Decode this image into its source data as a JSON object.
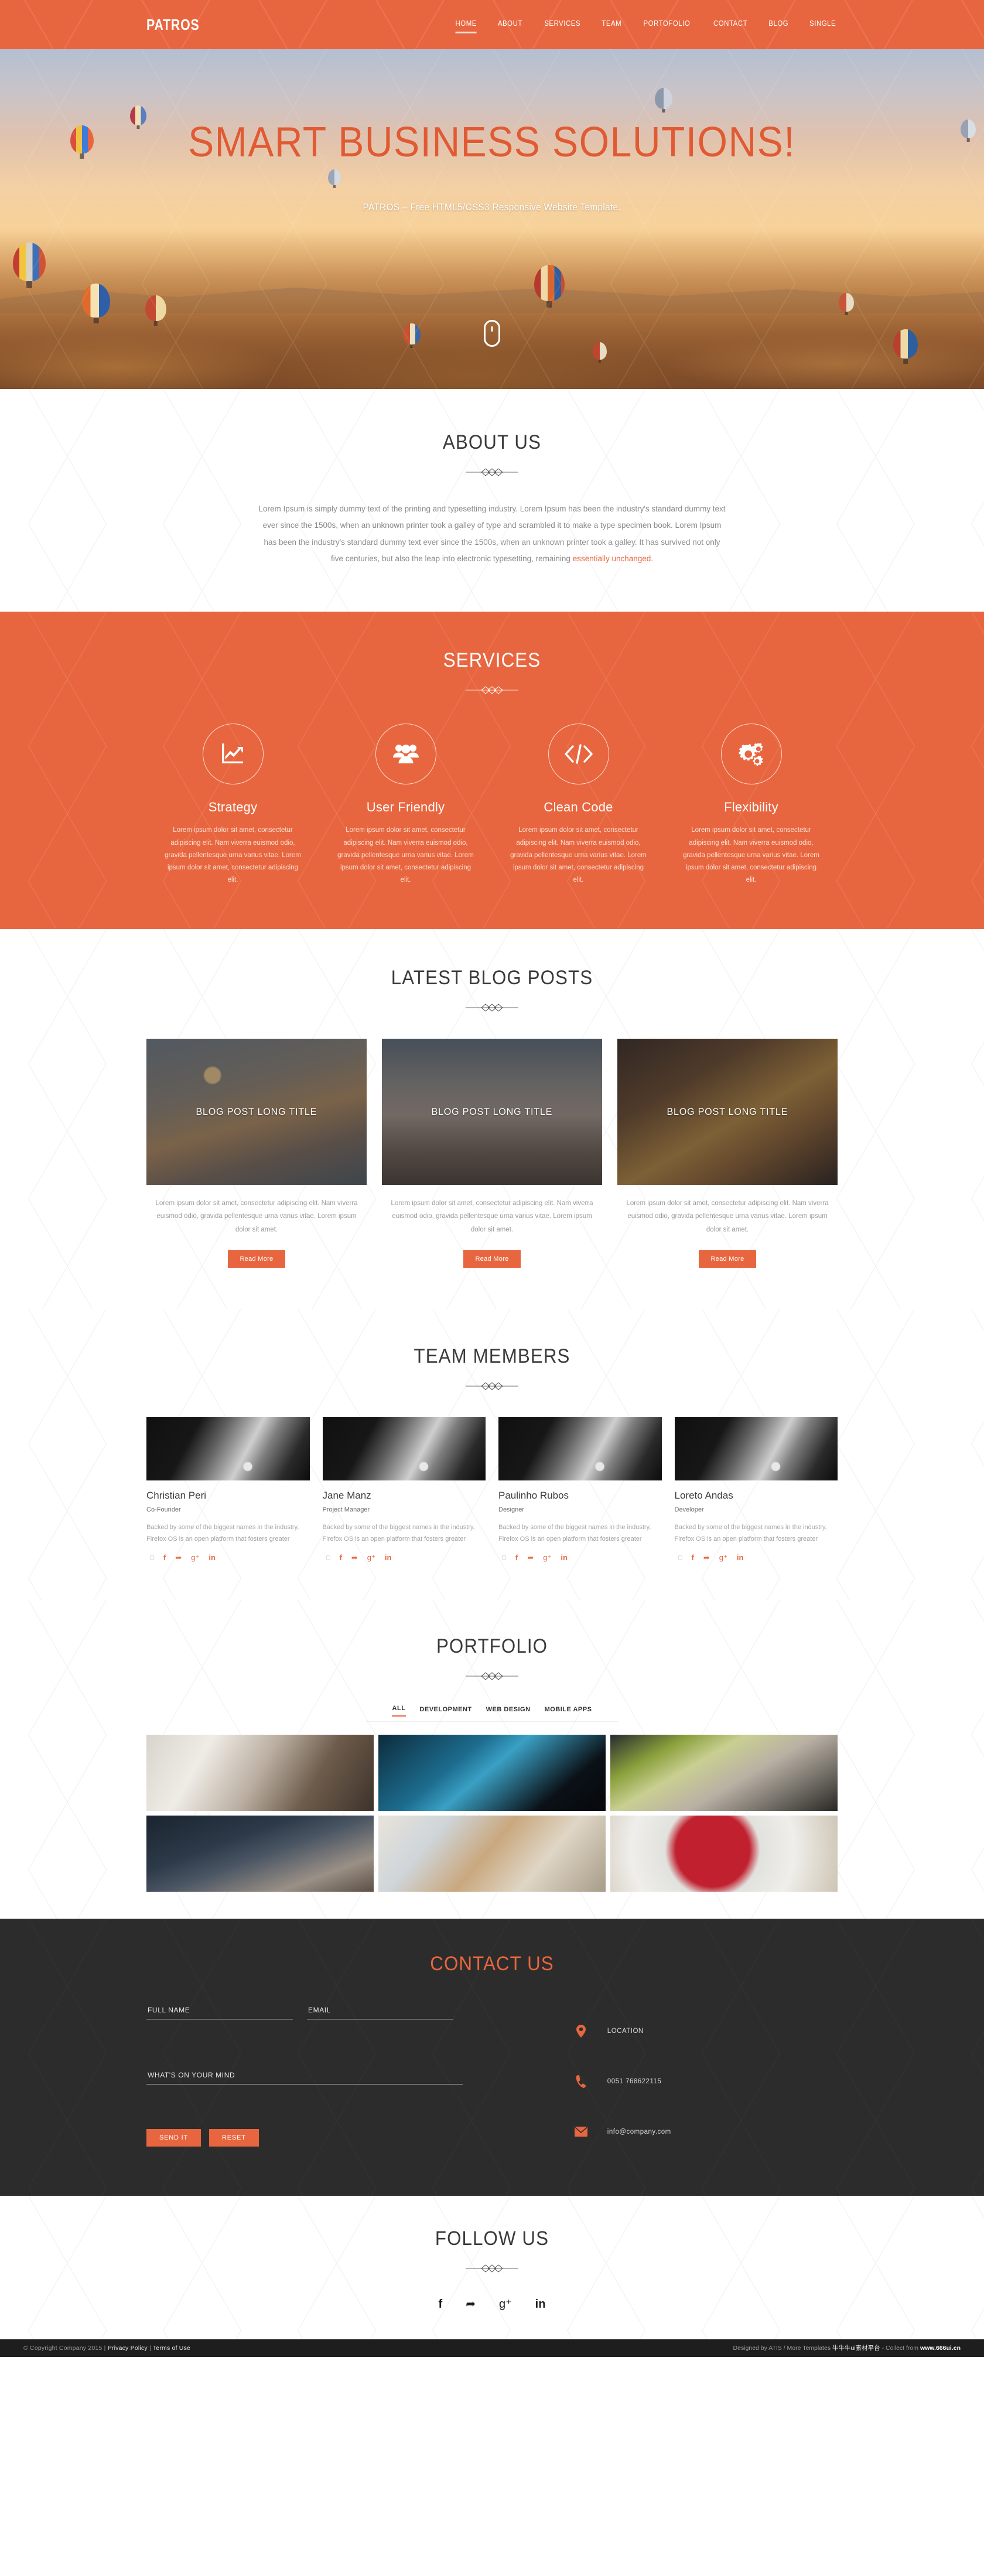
{
  "brand": {
    "logo": "PATROS",
    "accent": "#e8663f",
    "dark": "#2c2c2c"
  },
  "nav": {
    "items": [
      {
        "label": "HOME",
        "active": true
      },
      {
        "label": "ABOUT",
        "active": false
      },
      {
        "label": "SERVICES",
        "active": false
      },
      {
        "label": "TEAM",
        "active": false
      },
      {
        "label": "PORTOFOLIO",
        "active": false
      },
      {
        "label": "CONTACT",
        "active": false
      },
      {
        "label": "BLOG",
        "active": false
      },
      {
        "label": "SINGLE",
        "active": false
      }
    ]
  },
  "hero": {
    "title": "SMART BUSINESS SOLUTIONS!",
    "subtitle": "PATROS – Free HTML5/CSS3 Responsive Website Template.",
    "scroll_icon": "mouse-scroll-icon"
  },
  "about": {
    "title": "ABOUT US",
    "body": "Lorem Ipsum is simply dummy text of the printing and typesetting industry. Lorem Ipsum has been the industry's standard dummy text ever since the 1500s, when an unknown printer took a galley of type and scrambled it to make a type specimen book. Lorem Ipsum has been the industry's standard dummy text ever since the 1500s, when an unknown printer took a galley. It has survived not only five centuries, but also the leap into electronic typesetting, remaining ",
    "highlight": "essentially unchanged."
  },
  "services": {
    "title": "SERVICES",
    "items": [
      {
        "icon": "chart-growth-icon",
        "name": "Strategy",
        "desc": "Lorem ipsum dolor sit amet, consectetur adipiscing elit. Nam viverra euismod odio, gravida pellentesque urna varius vitae. Lorem ipsum dolor sit amet, consectetur adipiscing elit."
      },
      {
        "icon": "users-group-icon",
        "name": "User Friendly",
        "desc": "Lorem ipsum dolor sit amet, consectetur adipiscing elit. Nam viverra euismod odio, gravida pellentesque urna varius vitae. Lorem ipsum dolor sit amet, consectetur adipiscing elit."
      },
      {
        "icon": "code-brackets-icon",
        "name": "Clean Code",
        "desc": "Lorem ipsum dolor sit amet, consectetur adipiscing elit. Nam viverra euismod odio, gravida pellentesque urna varius vitae. Lorem ipsum dolor sit amet, consectetur adipiscing elit."
      },
      {
        "icon": "gears-icon",
        "name": "Flexibility",
        "desc": "Lorem ipsum dolor sit amet, consectetur adipiscing elit. Nam viverra euismod odio, gravida pellentesque urna varius vitae. Lorem ipsum dolor sit amet, consectetur adipiscing elit."
      }
    ]
  },
  "blog": {
    "title": "LATEST BLOG POSTS",
    "posts": [
      {
        "title": "BLOG POST LONG TITLE",
        "excerpt": "Lorem ipsum dolor sit amet, consectetur adipiscing elit. Nam viverra euismod odio, gravida pellentesque urna varius vitae. Lorem ipsum dolor sit amet.",
        "button": "Read More"
      },
      {
        "title": "BLOG POST LONG TITLE",
        "excerpt": "Lorem ipsum dolor sit amet, consectetur adipiscing elit. Nam viverra euismod odio, gravida pellentesque urna varius vitae. Lorem ipsum dolor sit amet.",
        "button": "Read More"
      },
      {
        "title": "BLOG POST LONG TITLE",
        "excerpt": "Lorem ipsum dolor sit amet, consectetur adipiscing elit. Nam viverra euismod odio, gravida pellentesque urna varius vitae. Lorem ipsum dolor sit amet.",
        "button": "Read More"
      }
    ]
  },
  "team": {
    "title": "TEAM MEMBERS",
    "members": [
      {
        "name": "Christian Peri",
        "role": "Co-Founder",
        "bio": "Backed by some of the biggest names in the industry, Firefox OS is an open platform that fosters greater"
      },
      {
        "name": "Jane Manz",
        "role": "Project Manager",
        "bio": "Backed by some of the biggest names in the industry, Firefox OS is an open platform that fosters greater"
      },
      {
        "name": "Paulinho Rubos",
        "role": "Designer",
        "bio": "Backed by some of the biggest names in the industry, Firefox OS is an open platform that fosters greater"
      },
      {
        "name": "Loreto Andas",
        "role": "Developer",
        "bio": "Backed by some of the biggest names in the industry, Firefox OS is an open platform that fosters greater"
      }
    ],
    "social": [
      {
        "icon": "facebook-icon",
        "glyph": "f"
      },
      {
        "icon": "twitter-icon",
        "glyph": "ᴠ"
      },
      {
        "icon": "google-plus-icon",
        "glyph": "g"
      },
      {
        "icon": "linkedin-icon",
        "glyph": "in"
      }
    ]
  },
  "portfolio": {
    "title": "PORTFOLIO",
    "filters": [
      {
        "label": "ALL",
        "active": true
      },
      {
        "label": "DEVELOPMENT",
        "active": false
      },
      {
        "label": "WEB DESIGN",
        "active": false
      },
      {
        "label": "MOBILE APPS",
        "active": false
      }
    ],
    "items": [
      {
        "name": "speaker-desk-photo"
      },
      {
        "name": "phone-in-hand-photo"
      },
      {
        "name": "mixing-console-photo"
      },
      {
        "name": "game-controller-photo"
      },
      {
        "name": "desk-flatlay-photo"
      },
      {
        "name": "raspberry-cup-photo"
      }
    ]
  },
  "contact": {
    "title": "CONTACT US",
    "fields": {
      "fullname_placeholder": "FULL NAME",
      "fullname_value": "",
      "email_placeholder": "EMAIL",
      "email_value": "",
      "message_placeholder": "WHAT'S ON YOUR MIND",
      "message_value": ""
    },
    "send_label": "SEND IT",
    "reset_label": "RESET",
    "info": [
      {
        "icon": "map-pin-icon",
        "text": "LOCATION"
      },
      {
        "icon": "phone-icon",
        "text": "0051 768622115"
      },
      {
        "icon": "envelope-icon",
        "text": "info@company.com"
      }
    ]
  },
  "follow": {
    "title": "FOLLOW US",
    "icons": [
      {
        "icon": "facebook-icon",
        "glyph": "f"
      },
      {
        "icon": "twitter-icon",
        "glyph": "ᴠ"
      },
      {
        "icon": "google-plus-icon",
        "glyph": "g"
      },
      {
        "icon": "linkedin-icon",
        "glyph": "in"
      }
    ]
  },
  "footer": {
    "copyright": "© Copyright Company 2015 | ",
    "privacy": "Privacy Policy",
    "sep": " | ",
    "terms": "Terms of Use",
    "credit_pre": "Designed by ATIS / More Templates ",
    "credit_cn": "牛牛牛ui素材平台",
    "credit_mid": " - Collect from ",
    "credit_site": "www.666ui.cn"
  }
}
